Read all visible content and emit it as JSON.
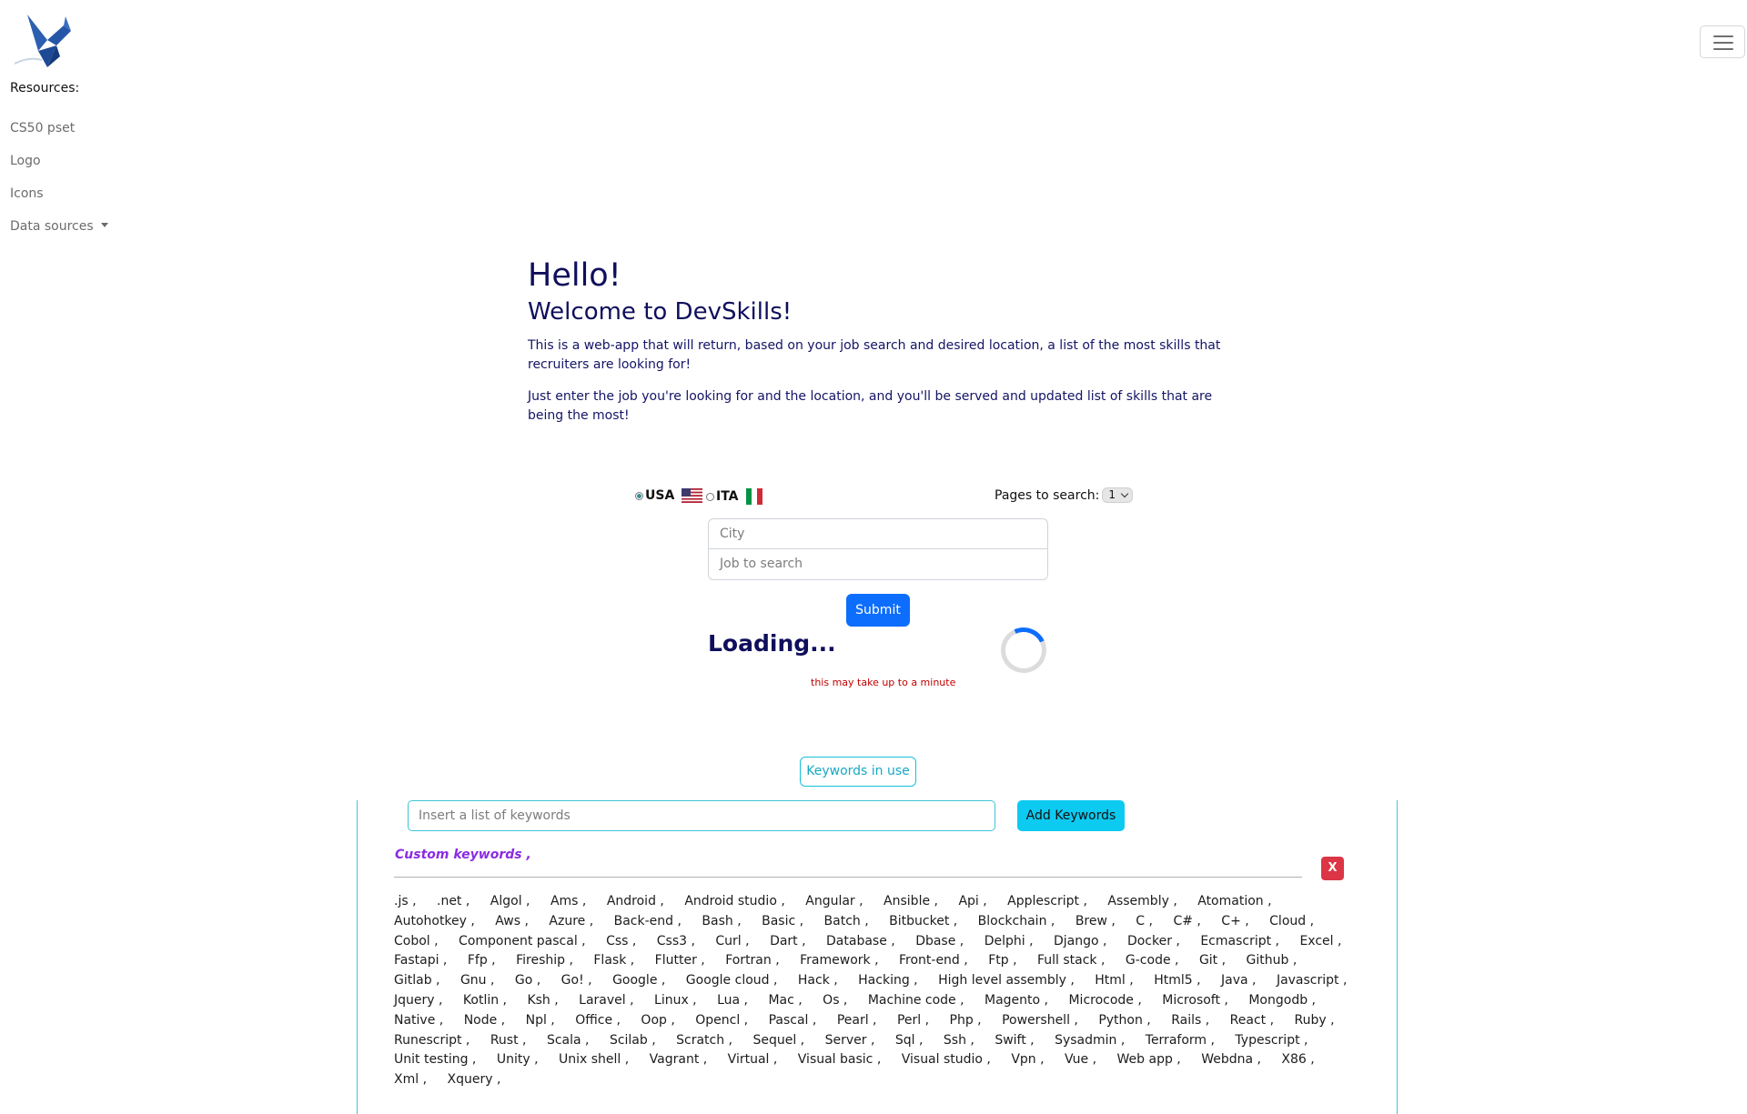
{
  "sidebar": {
    "logo_icon": "bird-logo-icon",
    "resources_label": "Resources:",
    "links": [
      "CS50 pset",
      "Logo",
      "Icons",
      "Data sources"
    ]
  },
  "header": {
    "menu_icon": "hamburger-menu-icon"
  },
  "hero": {
    "greeting": "Hello!",
    "welcome": "Welcome to DevSkills!",
    "description1": "This is a web-app that will return, based on your job search and desired location, a list of the most skills that recruiters are looking for!",
    "description2": "Just enter the job you're looking for and the location, and you'll be served and updated list of skills that are being the most!"
  },
  "search": {
    "country_usa": "USA",
    "country_ita": "ITA",
    "selected_country": "USA",
    "pages_label": "Pages to search:",
    "pages_value": "1",
    "city_placeholder": "City",
    "job_placeholder": "Job to search",
    "submit_label": "Submit"
  },
  "status": {
    "loading_text": "Loading...",
    "wait_note": "this may take up to a minute"
  },
  "keywords": {
    "toggle_label": "Keywords in use",
    "input_placeholder": "Insert a list of keywords",
    "add_label": "Add Keywords",
    "custom_label": "Custom keywords ,",
    "close_label": "X",
    "list": [
      ".js ,",
      ".net ,",
      "Algol ,",
      "Ams ,",
      "Android ,",
      "Android studio ,",
      "Angular ,",
      "Ansible ,",
      "Api ,",
      "Applescript ,",
      "Assembly ,",
      "Atomation ,",
      "Autohotkey ,",
      "Aws ,",
      "Azure ,",
      "Back-end ,",
      "Bash ,",
      "Basic ,",
      "Batch ,",
      "Bitbucket ,",
      "Blockchain ,",
      "Brew ,",
      "C ,",
      "C# ,",
      "C+ ,",
      "Cloud ,",
      "Cobol ,",
      "Component pascal ,",
      "Css ,",
      "Css3 ,",
      "Curl ,",
      "Dart ,",
      "Database ,",
      "Dbase ,",
      "Delphi ,",
      "Django ,",
      "Docker ,",
      "Ecmascript ,",
      "Excel ,",
      "Fastapi ,",
      "Ffp ,",
      "Fireship ,",
      "Flask ,",
      "Flutter ,",
      "Fortran ,",
      "Framework ,",
      "Front-end ,",
      "Ftp ,",
      "Full stack ,",
      "G-code ,",
      "Git ,",
      "Github ,",
      "Gitlab ,",
      "Gnu ,",
      "Go ,",
      "Go! ,",
      "Google ,",
      "Google cloud ,",
      "Hack ,",
      "Hacking ,",
      "High level assembly ,",
      "Html ,",
      "Html5 ,",
      "Java ,",
      "Javascript ,",
      "Jquery ,",
      "Kotlin ,",
      "Ksh ,",
      "Laravel ,",
      "Linux ,",
      "Lua ,",
      "Mac ,",
      "Os ,",
      "Machine code ,",
      "Magento ,",
      "Microcode ,",
      "Microsoft ,",
      "Mongodb ,",
      "Native ,",
      "Node ,",
      "Npl ,",
      "Office ,",
      "Oop ,",
      "Opencl ,",
      "Pascal ,",
      "Pearl ,",
      "Perl ,",
      "Php ,",
      "Powershell ,",
      "Python ,",
      "Rails ,",
      "React ,",
      "Ruby ,",
      "Runescript ,",
      "Rust ,",
      "Scala ,",
      "Scilab ,",
      "Scratch ,",
      "Sequel ,",
      "Server ,",
      "Sql ,",
      "Ssh ,",
      "Swift ,",
      "Sysadmin ,",
      "Terraform ,",
      "Typescript ,",
      "Unit testing ,",
      "Unity ,",
      "Unix shell ,",
      "Vagrant ,",
      "Virtual ,",
      "Visual basic ,",
      "Visual studio ,",
      "Vpn ,",
      "Vue ,",
      "Web app ,",
      "Webdna ,",
      "X86 ,",
      "Xml ,",
      "Xquery ,"
    ]
  }
}
